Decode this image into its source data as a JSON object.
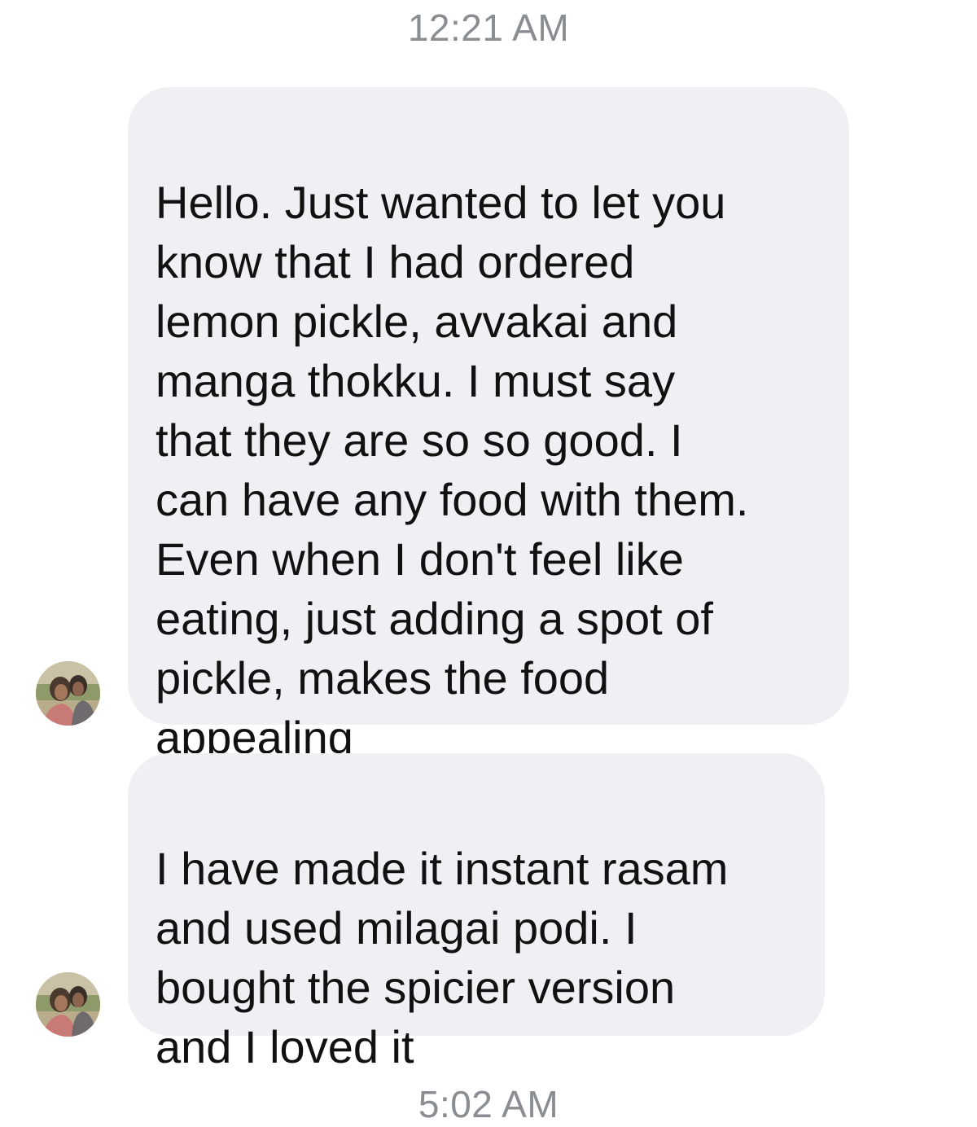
{
  "conversation": {
    "timestamp_top": "12:21 AM",
    "timestamp_bottom": "5:02 AM",
    "messages": [
      {
        "text": "Hello. Just wanted to let you\nknow that I had ordered\nlemon pickle, avvakai and\nmanga thokku. I must say\nthat they are so so good. I\ncan have any food with them.\nEven when I don't feel like\neating, just adding a spot of\npickle, makes the food\nappealing",
        "avatar_icon": "user-avatar"
      },
      {
        "text": "I have made it instant rasam\nand used milagai podi. I\nbought the spicier version\nand I loved it",
        "avatar_icon": "user-avatar"
      }
    ]
  },
  "colors": {
    "bubble_bg": "#f0f0f4",
    "timestamp": "#8a8d91",
    "text": "#111111"
  }
}
